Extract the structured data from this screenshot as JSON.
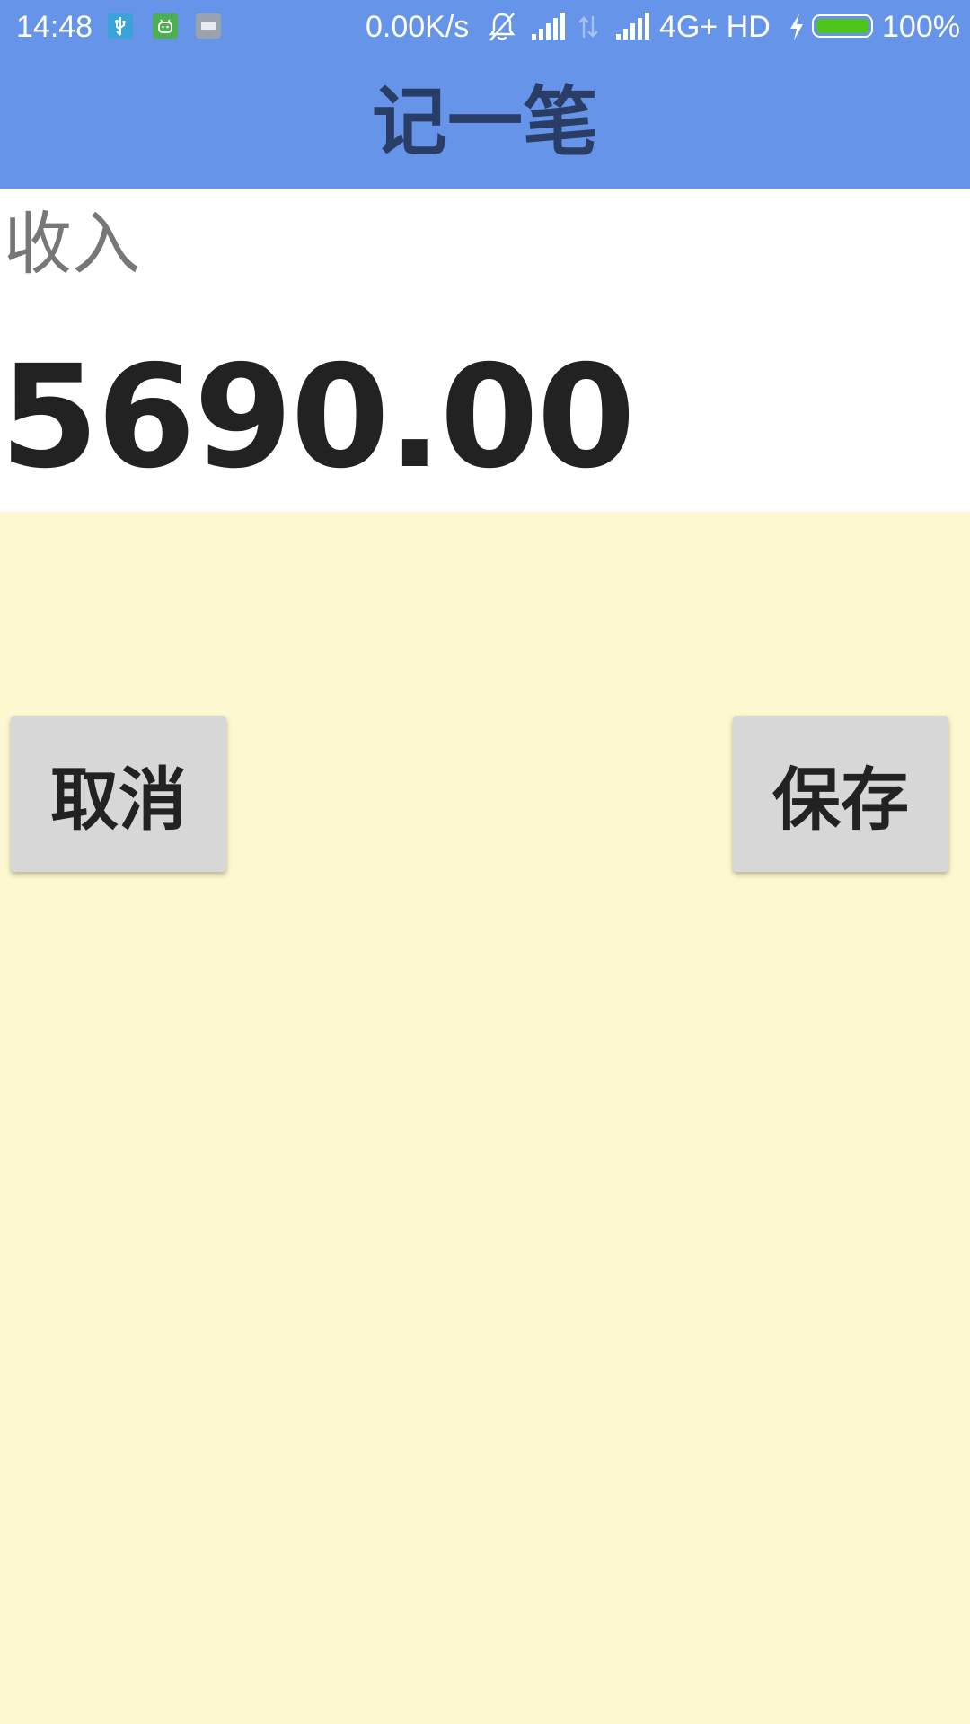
{
  "status_bar": {
    "time": "14:48",
    "network_speed": "0.00K/s",
    "network_type": "4G+ HD",
    "battery_percent": "100%",
    "battery_level": 1.0,
    "icons": [
      "usb-icon",
      "android-debug-icon",
      "document-icon",
      "bell-muted-icon",
      "signal-icon",
      "data-arrows-icon",
      "signal-icon",
      "charging-bolt-icon",
      "battery-icon"
    ]
  },
  "header": {
    "title": "记一笔"
  },
  "entry": {
    "type_label": "收入",
    "amount": "5690.00"
  },
  "actions": {
    "cancel_label": "取消",
    "save_label": "保存"
  },
  "colors": {
    "header_bg": "#6594e8",
    "title_text": "#2a3d66",
    "page_bg": "#fdf8cf",
    "button_bg": "#d7d7d7",
    "battery_fill": "#4fc51a"
  }
}
